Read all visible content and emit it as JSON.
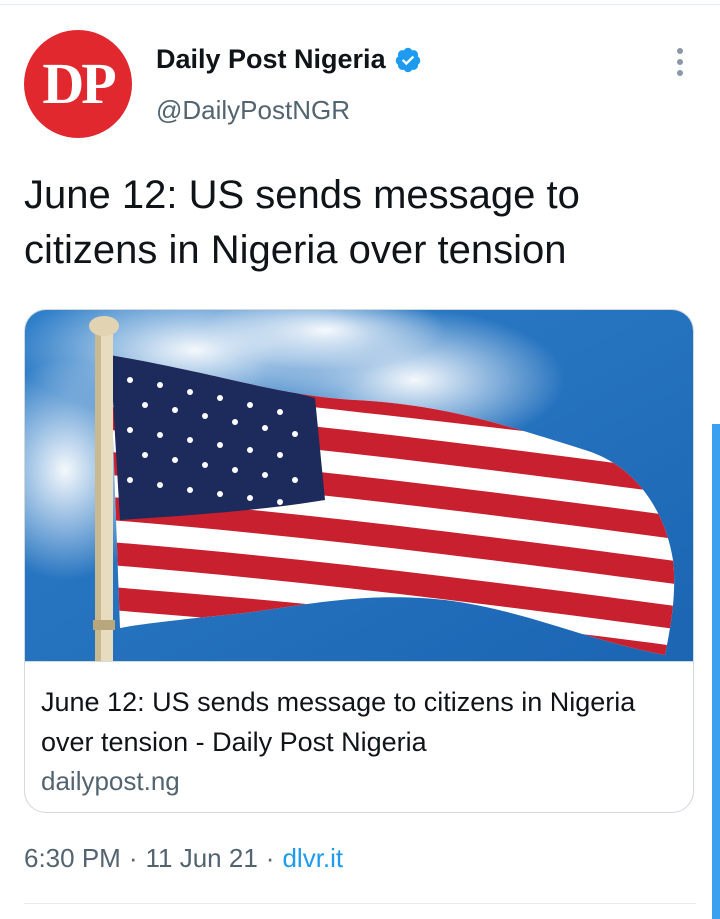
{
  "author": {
    "avatar_text": "DP",
    "display_name": "Daily Post Nigeria",
    "handle": "@DailyPostNGR",
    "verified_icon": "verified-badge-icon"
  },
  "tweet": {
    "text": "June 12: US sends message to citizens in Nigeria over tension"
  },
  "link_card": {
    "image_description": "American flag icon",
    "title": "June 12: US sends message to citizens in Nigeria over tension - Daily Post Nigeria",
    "domain": "dailypost.ng"
  },
  "meta": {
    "time": "6:30 PM",
    "separator": "·",
    "date": "11 Jun 21",
    "source": "dlvr.it"
  },
  "colors": {
    "brand_red": "#e0282e",
    "link_blue": "#1d9bf0",
    "muted_text": "#536471"
  }
}
